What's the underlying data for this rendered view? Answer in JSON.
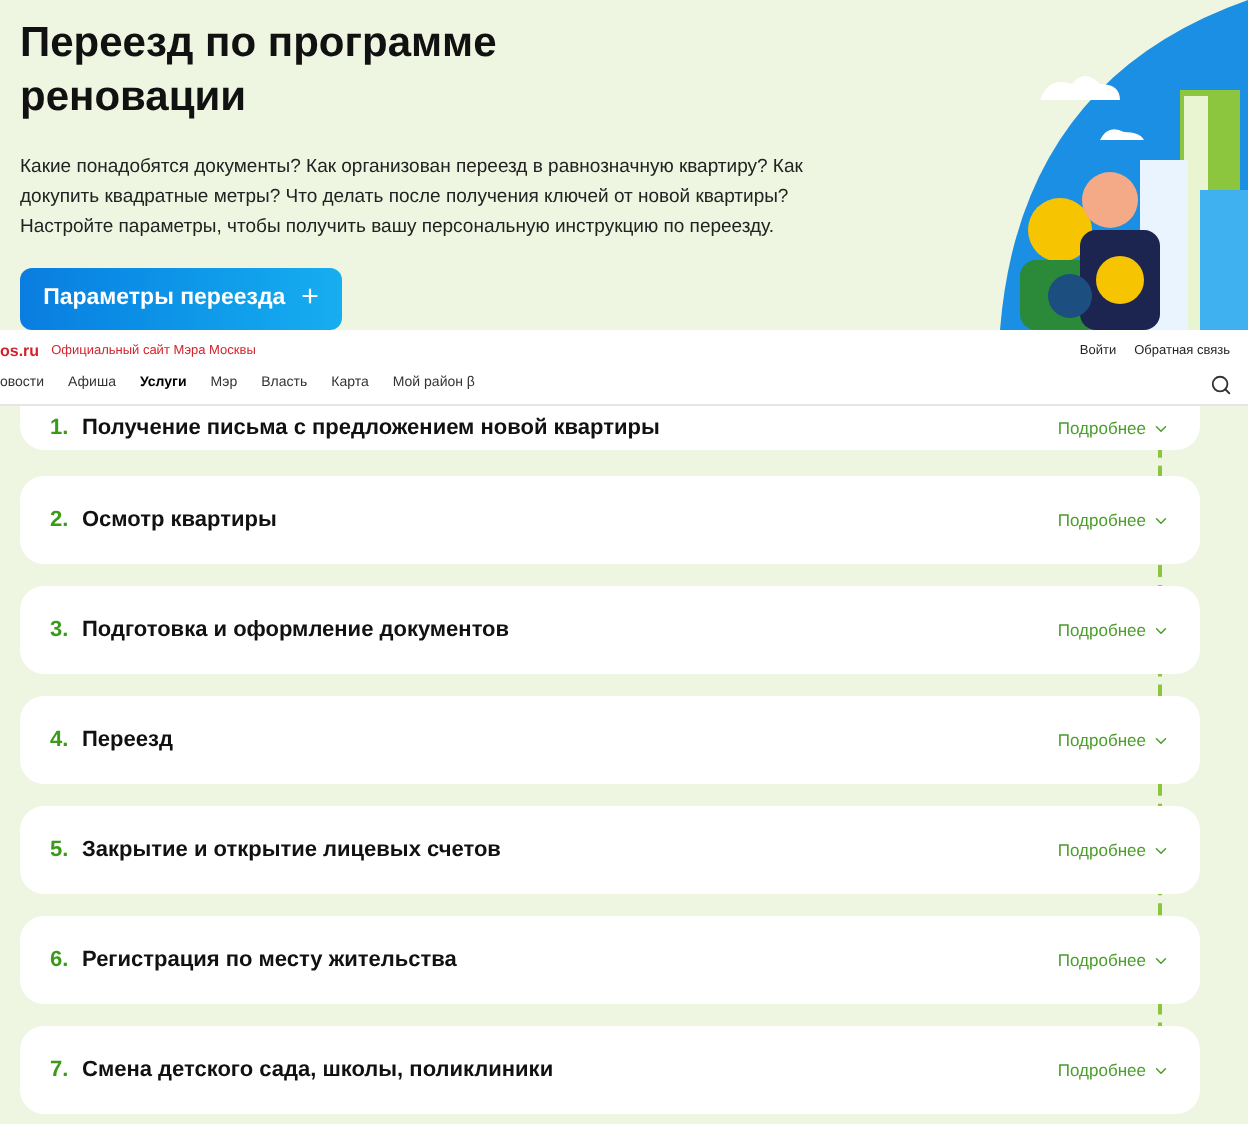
{
  "hero": {
    "title": "Переезд по программе реновации",
    "description": "Какие понадобятся документы? Как организован переезд в равнозначную квартиру? Как докупить квадратные метры? Что делать после получения ключей от новой квартиры? Настройте параметры, чтобы получить вашу персональную инструкцию по переезду.",
    "button": {
      "label": "Параметры переезда",
      "icon": "+"
    }
  },
  "header": {
    "logo": "os.ru",
    "tagline": "Официальный сайт Мэра Москвы",
    "links": [
      "Войти",
      "Обратная связь"
    ],
    "nav": [
      {
        "label": "овости",
        "selected": false
      },
      {
        "label": "Афиша",
        "selected": false
      },
      {
        "label": "Услуги",
        "selected": true
      },
      {
        "label": "Мэр",
        "selected": false
      },
      {
        "label": "Власть",
        "selected": false
      },
      {
        "label": "Карта",
        "selected": false
      },
      {
        "label": "Мой район β",
        "selected": false
      }
    ]
  },
  "steps": [
    {
      "number": "1.",
      "title": "Получение письма с предложением новой квартиры",
      "more": "Подробнее"
    },
    {
      "number": "2.",
      "title": "Осмотр квартиры",
      "more": "Подробнее"
    },
    {
      "number": "3.",
      "title": "Подготовка и оформление документов",
      "more": "Подробнее"
    },
    {
      "number": "4.",
      "title": "Переезд",
      "more": "Подробнее"
    },
    {
      "number": "5.",
      "title": "Закрытие и открытие лицевых счетов",
      "more": "Подробнее"
    },
    {
      "number": "6.",
      "title": "Регистрация по месту жительства",
      "more": "Подробнее"
    },
    {
      "number": "7.",
      "title": "Смена детского сада, школы, поликлиники",
      "more": "Подробнее"
    }
  ]
}
